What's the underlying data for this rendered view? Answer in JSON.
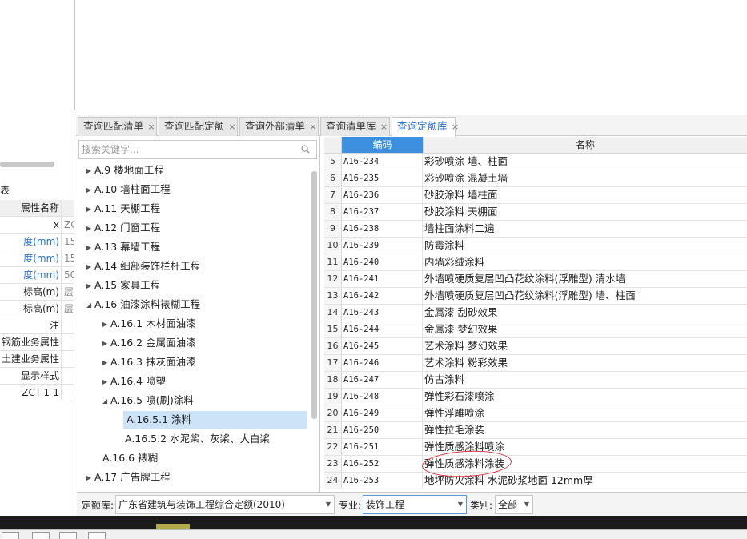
{
  "left_table": {
    "title": "表",
    "header": "属性名称",
    "header_value": "",
    "rows": [
      {
        "name": "x",
        "value": "ZC",
        "blue": false
      },
      {
        "name": "度(mm)",
        "value": "15",
        "blue": true
      },
      {
        "name": "度(mm)",
        "value": "15",
        "blue": true
      },
      {
        "name": "度(mm)",
        "value": "50",
        "blue": true
      },
      {
        "name": "标高(m)",
        "value": "层",
        "blue": false
      },
      {
        "name": "标高(m)",
        "value": "层",
        "blue": false
      },
      {
        "name": "注",
        "value": "",
        "blue": false
      },
      {
        "name": "钢筋业务属性",
        "value": "",
        "blue": false
      },
      {
        "name": "土建业务属性",
        "value": "",
        "blue": false
      },
      {
        "name": "显示样式",
        "value": "",
        "blue": false
      },
      {
        "name": "ZCT-1-1",
        "value": "",
        "blue": false
      }
    ]
  },
  "tabs": [
    {
      "label": "查询匹配清单",
      "close": "×",
      "active": false
    },
    {
      "label": "查询匹配定额",
      "close": "×",
      "active": false
    },
    {
      "label": "查询外部清单",
      "close": "×",
      "active": false
    },
    {
      "label": "查询清单库",
      "close": "×",
      "active": false
    },
    {
      "label": "查询定额库",
      "close": "×",
      "active": true
    }
  ],
  "search": {
    "placeholder": "搜索关键字..."
  },
  "tree": [
    {
      "label": "A.9 楼地面工程",
      "arrow": "▶",
      "level": 0,
      "selected": false
    },
    {
      "label": "A.10 墙柱面工程",
      "arrow": "▶",
      "level": 0,
      "selected": false
    },
    {
      "label": "A.11 天棚工程",
      "arrow": "▶",
      "level": 0,
      "selected": false
    },
    {
      "label": "A.12 门窗工程",
      "arrow": "▶",
      "level": 0,
      "selected": false
    },
    {
      "label": "A.13 幕墙工程",
      "arrow": "▶",
      "level": 0,
      "selected": false
    },
    {
      "label": "A.14 细部装饰栏杆工程",
      "arrow": "▶",
      "level": 0,
      "selected": false
    },
    {
      "label": "A.15 家具工程",
      "arrow": "▶",
      "level": 0,
      "selected": false
    },
    {
      "label": "A.16 油漆涂料裱糊工程",
      "arrow": "◢",
      "level": 0,
      "selected": false
    },
    {
      "label": "A.16.1 木材面油漆",
      "arrow": "▶",
      "level": 1,
      "selected": false
    },
    {
      "label": "A.16.2 金属面油漆",
      "arrow": "▶",
      "level": 1,
      "selected": false
    },
    {
      "label": "A.16.3 抹灰面油漆",
      "arrow": "▶",
      "level": 1,
      "selected": false
    },
    {
      "label": "A.16.4 喷塑",
      "arrow": "▶",
      "level": 1,
      "selected": false
    },
    {
      "label": "A.16.5 喷(刷)涂料",
      "arrow": "◢",
      "level": 1,
      "selected": false
    },
    {
      "label": "A.16.5.1 涂料",
      "arrow": "",
      "level": 2,
      "selected": true
    },
    {
      "label": "A.16.5.2 水泥桨、灰桨、大白桨",
      "arrow": "",
      "level": 2,
      "selected": false
    },
    {
      "label": "A.16.6 裱糊",
      "arrow": "",
      "level": 1,
      "selected": false
    },
    {
      "label": "A.17 广告牌工程",
      "arrow": "▶",
      "level": 0,
      "selected": false
    }
  ],
  "grid": {
    "columns": {
      "code": "编码",
      "name": "名称"
    },
    "rows": [
      {
        "num": "5",
        "code": "A16-234",
        "name": "彩砂喷涂 墙、柱面"
      },
      {
        "num": "6",
        "code": "A16-235",
        "name": "彩砂喷涂 混凝土墙"
      },
      {
        "num": "7",
        "code": "A16-236",
        "name": "砂胶涂料 墙柱面"
      },
      {
        "num": "8",
        "code": "A16-237",
        "name": "砂胶涂料 天棚面"
      },
      {
        "num": "9",
        "code": "A16-238",
        "name": "墙柱面涂料二遍"
      },
      {
        "num": "10",
        "code": "A16-239",
        "name": "防霉涂料"
      },
      {
        "num": "11",
        "code": "A16-240",
        "name": "内墙彩绒涂料"
      },
      {
        "num": "12",
        "code": "A16-241",
        "name": "外墙喷硬质复层凹凸花纹涂料(浮雕型) 清水墙"
      },
      {
        "num": "13",
        "code": "A16-242",
        "name": "外墙喷硬质复层凹凸花纹涂料(浮雕型) 墙、柱面"
      },
      {
        "num": "14",
        "code": "A16-243",
        "name": "金属漆 刮砂效果"
      },
      {
        "num": "15",
        "code": "A16-244",
        "name": "金属漆 梦幻效果"
      },
      {
        "num": "16",
        "code": "A16-245",
        "name": "艺术涂料 梦幻效果"
      },
      {
        "num": "17",
        "code": "A16-246",
        "name": "艺术涂料 粉彩效果"
      },
      {
        "num": "18",
        "code": "A16-247",
        "name": "仿古涂料"
      },
      {
        "num": "19",
        "code": "A16-248",
        "name": "弹性彩石漆喷涂"
      },
      {
        "num": "20",
        "code": "A16-249",
        "name": "弹性浮雕喷涂"
      },
      {
        "num": "21",
        "code": "A16-250",
        "name": "弹性拉毛涂装"
      },
      {
        "num": "22",
        "code": "A16-251",
        "name": "弹性质感涂料喷涂"
      },
      {
        "num": "23",
        "code": "A16-252",
        "name": "弹性质感涂料涂装"
      },
      {
        "num": "24",
        "code": "A16-253",
        "name": "地坪防火涂料 水泥砂浆地面 12mm厚"
      }
    ]
  },
  "filter": {
    "quota_label": "定额库:",
    "quota_value": "广东省建筑与装饰工程综合定额(2010)",
    "major_label": "专业:",
    "major_value": "装饰工程",
    "category_label": "类别:",
    "category_value": "全部"
  },
  "colors": {
    "accent": "#2a6fc9",
    "header_blue": "#3d8fe0",
    "selection": "#cde3f7",
    "annotation": "#d8323c"
  }
}
